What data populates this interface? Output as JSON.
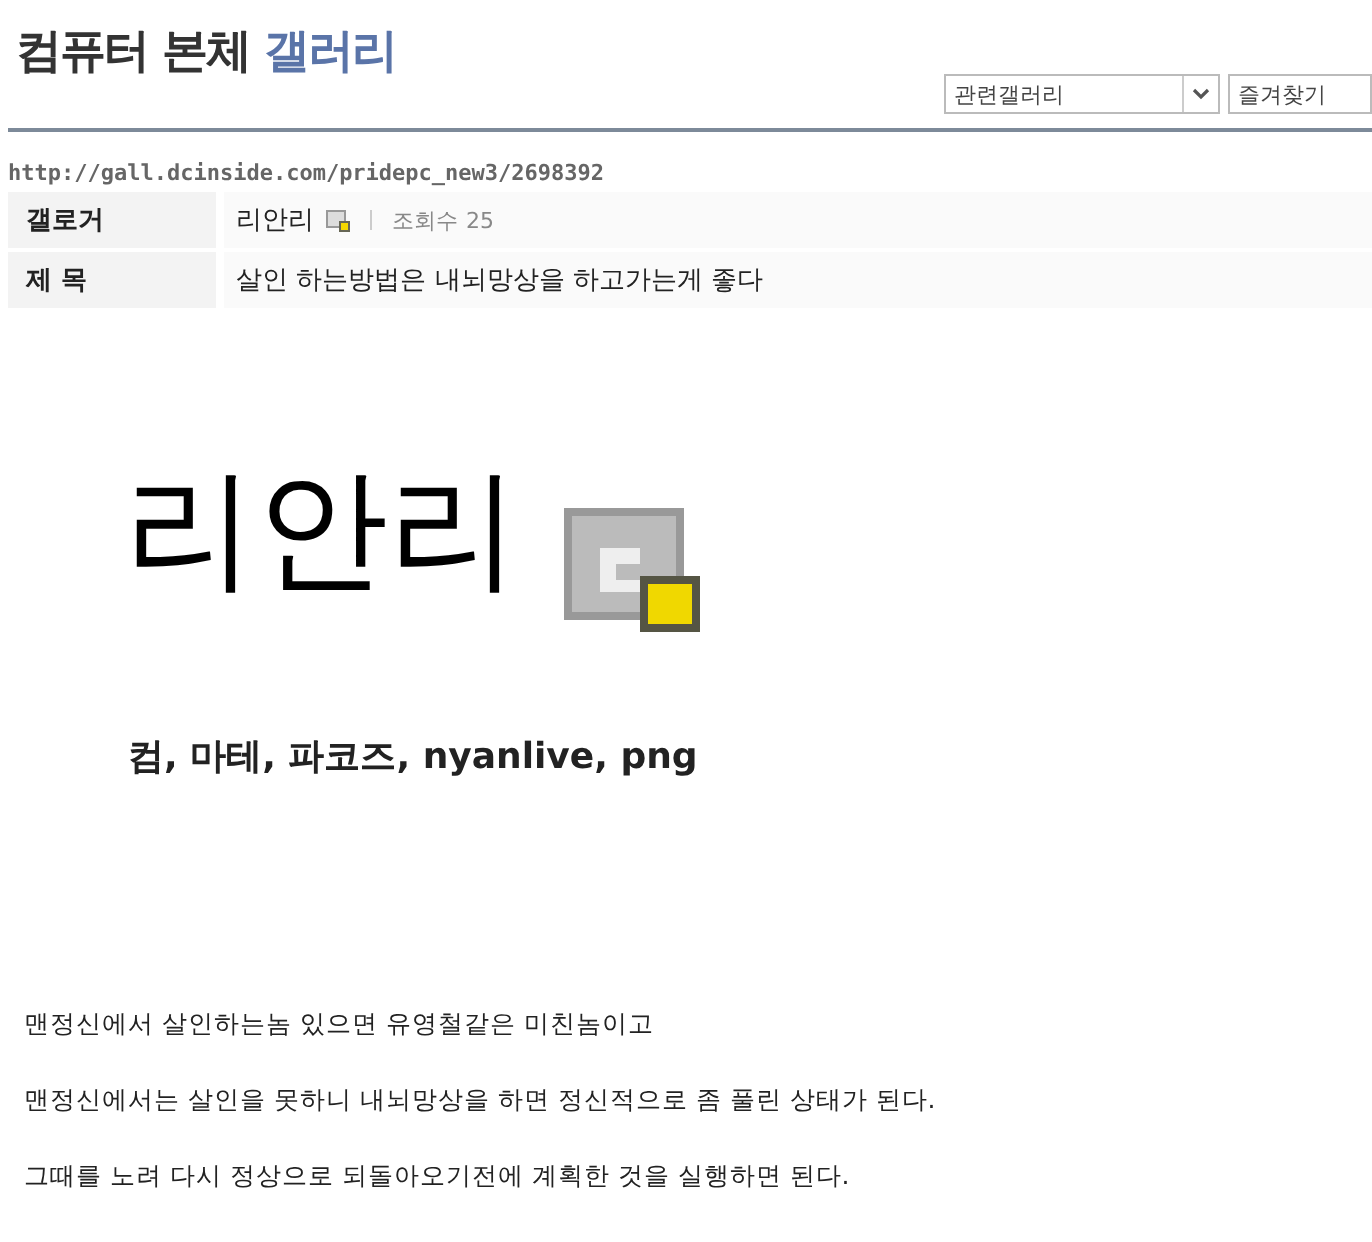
{
  "header": {
    "title": "컴퓨터 본체",
    "title_accent": "갤러리",
    "related_select": "관련갤러리",
    "favorites_select": "즐겨찾기"
  },
  "url": "http://gall.dcinside.com/pridepc_new3/2698392",
  "info": {
    "writer_label": "갤로거",
    "writer": "리안리",
    "views_label": "조회수",
    "views": "25",
    "subject_label": "제 목",
    "subject": "살인 하는방법은 내뇌망상을 하고가는게 좋다"
  },
  "post_image": {
    "big_text": "리안리",
    "caption": "컴, 마테, 파코즈, nyanlive, png"
  },
  "paragraphs": [
    "맨정신에서 살인하는놈 있으면 유영철같은 미친놈이고",
    "맨정신에서는 살인을 못하니 내뇌망상을 하면 정신적으로 좀 풀린 상태가 된다.",
    "그때를 노려 다시 정상으로 되돌아오기전에 계획한 것을 실행하면 된다."
  ]
}
